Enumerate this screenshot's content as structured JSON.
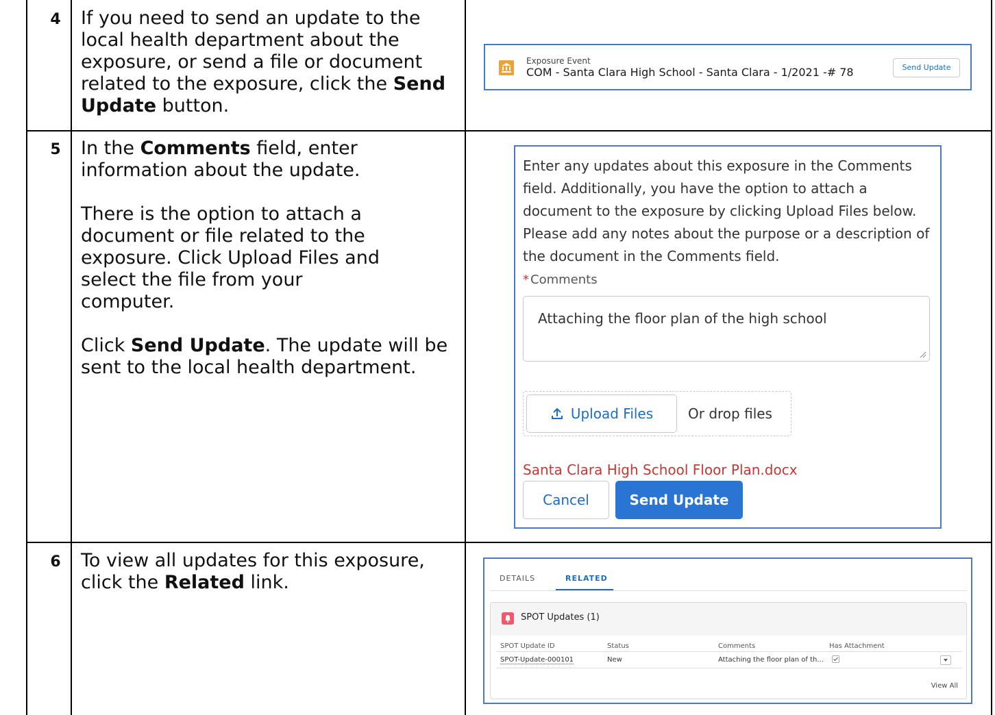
{
  "steps": [
    {
      "number": "4",
      "parts": [
        {
          "text": "If you need to send an update to the local health department about the exposure, or send a file or document related to the exposure, click the "
        },
        {
          "text": "Send Update",
          "bold": true
        },
        {
          "text": " button."
        }
      ]
    },
    {
      "number": "5",
      "paragraphs": [
        [
          {
            "text": "In the "
          },
          {
            "text": "Comments",
            "bold": true
          },
          {
            "text": " field, enter information about the update."
          }
        ],
        [
          {
            "text": "There is the option to attach a document or file related to the exposure. Click Upload Files and select the file from your computer."
          }
        ],
        [
          {
            "text": "Click "
          },
          {
            "text": "Send Update",
            "bold": true
          },
          {
            "text": ". The update will be sent to the local health department."
          }
        ]
      ]
    },
    {
      "number": "6",
      "parts": [
        {
          "text": "To view all updates for this exposure, click the "
        },
        {
          "text": "Related",
          "bold": true
        },
        {
          "text": " link."
        }
      ]
    }
  ],
  "exposure_header": {
    "object_label": "Exposure Event",
    "record_title": "COM - Santa Clara High School - Santa Clara - 1/2021 -# 78",
    "send_update_label": "Send Update",
    "icon": "institution-icon",
    "icon_color": "#e8a33c"
  },
  "update_form": {
    "instructions": "Enter any updates about this exposure in the Comments field. Additionally, you have the option to attach a document to the exposure by clicking Upload Files below. Please add any notes about the purpose or a description of the document in the Comments field.",
    "required_marker": "*",
    "comments_label": "Comments",
    "comments_value": "Attaching the floor plan of the high school",
    "upload_label": "Upload Files",
    "drop_label": "Or drop files",
    "attached_file": "Santa Clara High School Floor Plan.docx",
    "cancel_label": "Cancel",
    "send_label": "Send Update",
    "accent_color": "#2a74d3",
    "file_color": "#c23934"
  },
  "related_view": {
    "tabs": [
      {
        "label": "DETAILS",
        "active": false
      },
      {
        "label": "RELATED",
        "active": true
      }
    ],
    "card_title": "SPOT Updates (1)",
    "card_icon": "bell-icon",
    "card_icon_color": "#f0596c",
    "columns": [
      "SPOT Update ID",
      "Status",
      "Comments",
      "Has Attachment"
    ],
    "rows": [
      {
        "id": "SPOT-Update-000101",
        "status": "New",
        "comments": "Attaching the floor plan of th...",
        "has_attachment": true
      }
    ],
    "view_all_label": "View All"
  }
}
